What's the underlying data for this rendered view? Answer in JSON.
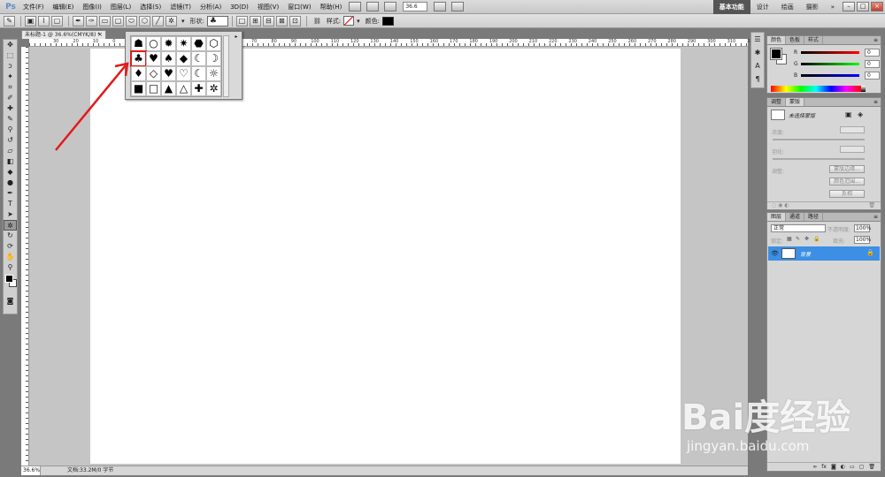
{
  "menubar": {
    "logo": "Ps",
    "items": [
      "文件(F)",
      "编辑(E)",
      "图像(I)",
      "图层(L)",
      "选择(S)",
      "滤镜(T)",
      "分析(A)",
      "3D(D)",
      "视图(V)",
      "窗口(W)",
      "帮助(H)"
    ],
    "zoom": "36.6",
    "workspaces": [
      "基本功能",
      "设计",
      "绘画",
      "摄影"
    ],
    "more": "»",
    "window_buttons": [
      "–",
      "□",
      "×"
    ]
  },
  "optionsbar": {
    "shape_label": "形状:",
    "shape_value": "♣",
    "style_label": "样式:",
    "color_label": "颜色:",
    "color": "#000000"
  },
  "document": {
    "tab_title": "未标题-1 @ 36.6%(CMYK/8) *",
    "close": "×",
    "ruler_h_labels": [
      "30",
      "20",
      "10",
      "0",
      "10",
      "20",
      "30",
      "40",
      "50",
      "60",
      "70",
      "80",
      "90",
      "100",
      "110",
      "120",
      "130",
      "140",
      "150",
      "160",
      "170",
      "180",
      "190",
      "200",
      "210",
      "220",
      "230",
      "240",
      "250",
      "260",
      "270",
      "280",
      "290",
      "300",
      "310",
      "320"
    ],
    "status_zoom": "36.6%",
    "status_doc": "文档:33.2M/0 字节"
  },
  "shape_popup": {
    "shapes": [
      "☗",
      "○",
      "✹",
      "✷",
      "⬣",
      "⬡",
      "♣",
      "♥",
      "♠",
      "◆",
      "☾",
      "☽",
      "♦",
      "◇",
      "♥",
      "♡",
      "☾",
      "☼",
      "■",
      "□",
      "▲",
      "△",
      "✚",
      "✲"
    ],
    "selected_index": 6,
    "menu": "▸"
  },
  "colors": {
    "accent": "#3c8fe4",
    "arrow": "#e21a1a"
  },
  "color_panel": {
    "tabs": [
      "颜色",
      "色板",
      "样式"
    ],
    "rows": [
      {
        "label": "R",
        "value": "0"
      },
      {
        "label": "G",
        "value": "0"
      },
      {
        "label": "B",
        "value": "0"
      }
    ]
  },
  "masks_panel": {
    "tabs": [
      "调整",
      "蒙版"
    ],
    "status": "未选择蒙版",
    "density_label": "浓度:",
    "feather_label": "羽化:",
    "refine_label": "调整:",
    "buttons": [
      "蒙版边缘...",
      "颜色范围...",
      "反相"
    ]
  },
  "layers_panel": {
    "tabs": [
      "图层",
      "通道",
      "路径"
    ],
    "blend_mode": "正常",
    "opacity_label": "不透明度:",
    "opacity": "100%",
    "lock_label": "锁定:",
    "fill_label": "填充:",
    "fill": "100%",
    "layer_name": "背景"
  },
  "watermark": {
    "logo": "Bai度经验",
    "url": "jingyan.baidu.com"
  }
}
